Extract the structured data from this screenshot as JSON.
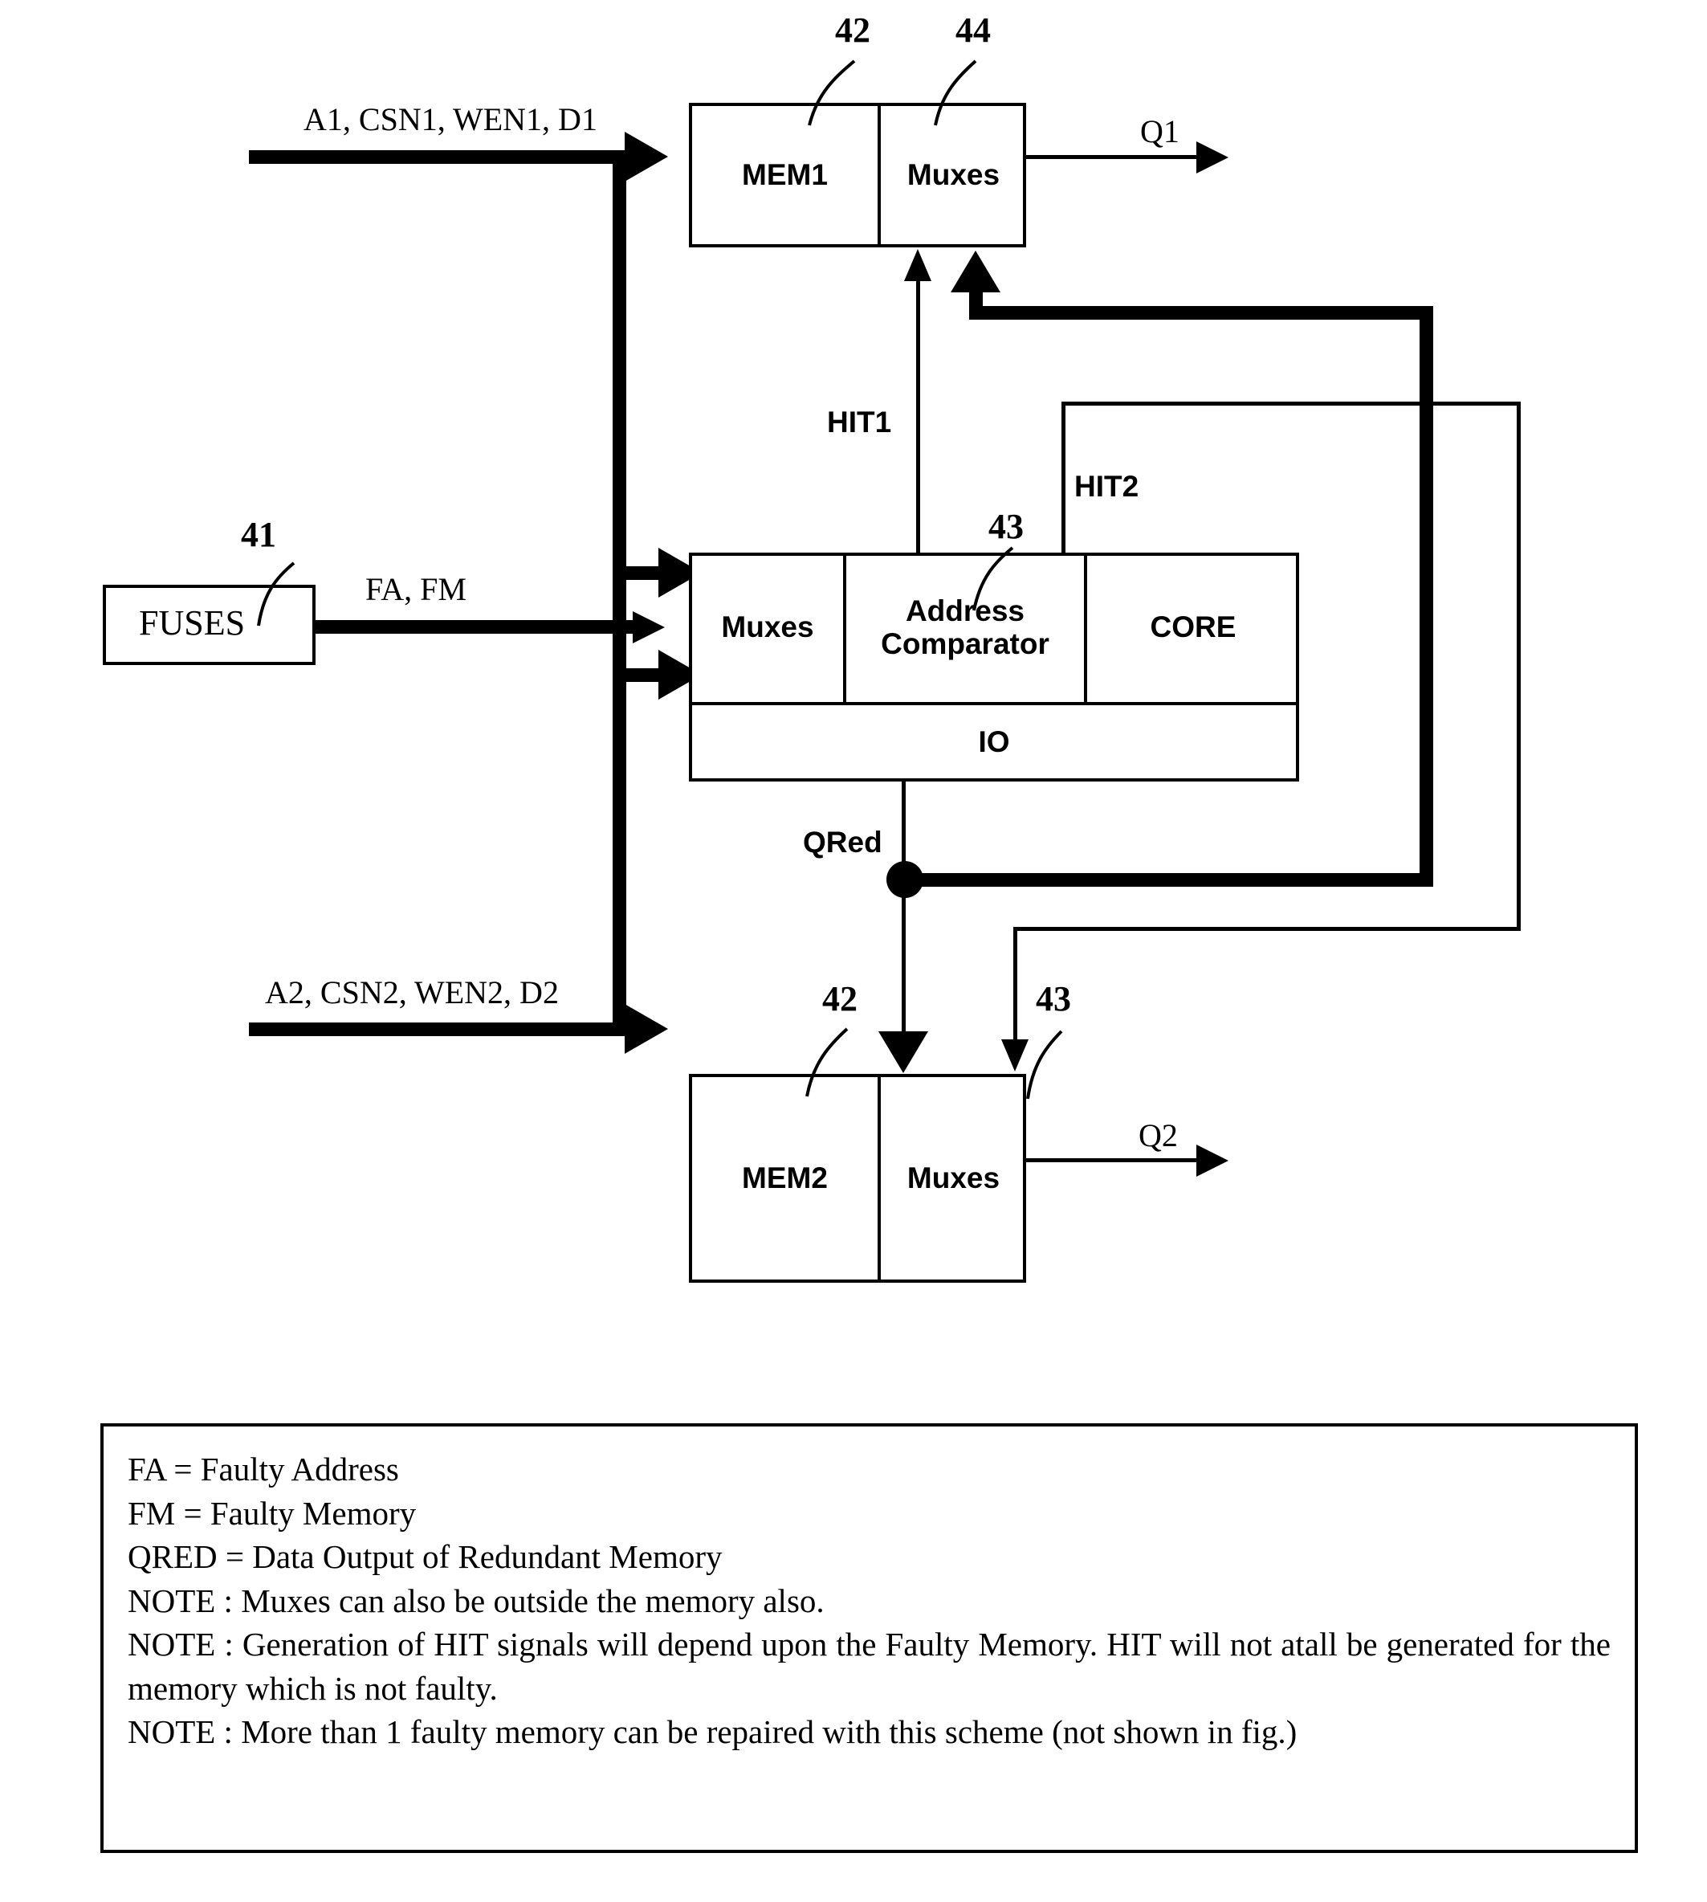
{
  "figure": {
    "blocks": {
      "mem1": {
        "label": "MEM1",
        "ref": "42"
      },
      "mem1_muxes": {
        "label": "Muxes",
        "ref": "44"
      },
      "mem2": {
        "label": "MEM2",
        "ref": "42"
      },
      "mem2_muxes": {
        "label": "Muxes",
        "ref": "43"
      },
      "fuses": {
        "label": "FUSES",
        "ref": "41"
      },
      "red_muxes": {
        "label": "Muxes"
      },
      "addr_comparator": {
        "label": "Address\nComparator",
        "ref": "43"
      },
      "core": {
        "label": "CORE"
      },
      "io": {
        "label": "IO"
      }
    },
    "signals": {
      "input1": "A1, CSN1, WEN1, D1",
      "input2": "A2, CSN2, WEN2, D2",
      "fuse_out": "FA, FM",
      "out1": "Q1",
      "out2": "Q2",
      "hit1": "HIT1",
      "hit2": "HIT2",
      "qred": "QRed"
    }
  },
  "legend": {
    "lines": [
      "FA = Faulty Address",
      "FM = Faulty Memory",
      "QRED = Data Output of Redundant Memory",
      "NOTE : Muxes can also be outside the memory also."
    ],
    "note_hit": "NOTE : Generation of HIT signals will depend upon the Faulty Memory. HIT will not atall be generated for the memory which is not faulty.",
    "note_more": "NOTE : More than 1 faulty memory can be repaired with this scheme (not shown in fig.)"
  },
  "colors": {
    "ink": "#000000",
    "paper": "#ffffff"
  }
}
